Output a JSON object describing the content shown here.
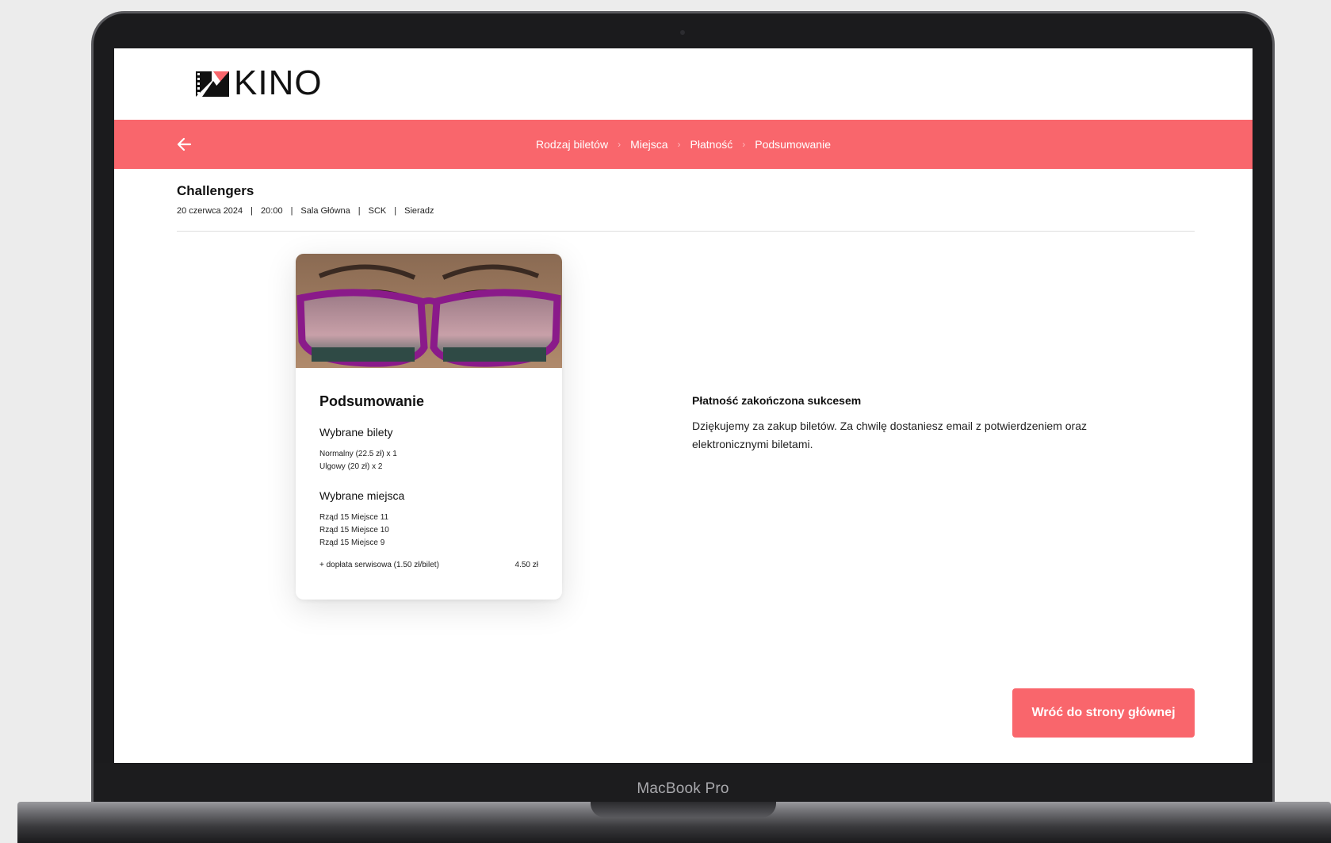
{
  "device": {
    "label": "MacBook Pro"
  },
  "header": {
    "logo_text": "KINO"
  },
  "steps": {
    "items": [
      {
        "label": "Rodzaj biletów"
      },
      {
        "label": "Miejsca"
      },
      {
        "label": "Płatność"
      },
      {
        "label": "Podsumowanie"
      }
    ],
    "separator": "›"
  },
  "movie": {
    "title": "Challengers",
    "date": "20 czerwca 2024",
    "time": "20:00",
    "hall": "Sala Główna",
    "venue": "SCK",
    "city": "Sieradz",
    "separator": "|"
  },
  "summary": {
    "title": "Podsumowanie",
    "tickets_heading": "Wybrane bilety",
    "tickets": [
      "Normalny (22.5 zł) x 1",
      "Ulgowy (20 zł) x 2"
    ],
    "seats_heading": "Wybrane miejsca",
    "seats": [
      "Rząd 15 Miejsce 11",
      "Rząd 15 Miejsce 10",
      "Rząd 15 Miejsce 9"
    ],
    "fee_label": "+ dopłata serwisowa (1.50 zł/bilet)",
    "fee_value": "4.50 zł"
  },
  "message": {
    "title": "Płatność zakończona sukcesem",
    "text": "Dziękujemy za zakup biletów. Za chwilę dostaniesz email z potwierdzeniem oraz elektronicznymi biletami."
  },
  "actions": {
    "home_label": "Wróć do strony głównej"
  },
  "colors": {
    "accent": "#f9666c",
    "text": "#111111"
  }
}
